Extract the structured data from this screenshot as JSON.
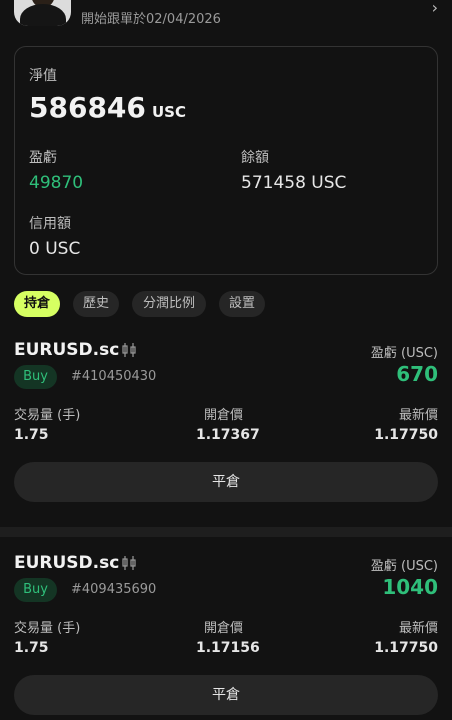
{
  "header": {
    "follow_since": "開始跟單於02/04/2026",
    "chevron": "›"
  },
  "account": {
    "equity_label": "淨值",
    "equity_value": "586846",
    "equity_unit": "USC",
    "pnl_label": "盈虧",
    "pnl_value": "49870",
    "balance_label": "餘額",
    "balance_value": "571458 USC",
    "credit_label": "信用額",
    "credit_value": "0 USC"
  },
  "tabs": [
    {
      "label": "持倉",
      "active": true
    },
    {
      "label": "歷史",
      "active": false
    },
    {
      "label": "分潤比例",
      "active": false
    },
    {
      "label": "設置",
      "active": false
    }
  ],
  "positions": [
    {
      "symbol": "EURUSD.sc",
      "side": "Buy",
      "ticket": "#410450430",
      "pnl_label": "盈虧 (USC)",
      "pnl_value": "670",
      "volume_label": "交易量 (手)",
      "volume": "1.75",
      "open_label": "開倉價",
      "open_price": "1.17367",
      "latest_label": "最新價",
      "latest_price": "1.17750",
      "close_label": "平倉"
    },
    {
      "symbol": "EURUSD.sc",
      "side": "Buy",
      "ticket": "#409435690",
      "pnl_label": "盈虧 (USC)",
      "pnl_value": "1040",
      "volume_label": "交易量 (手)",
      "volume": "1.75",
      "open_label": "開倉價",
      "open_price": "1.17156",
      "latest_label": "最新價",
      "latest_price": "1.17750",
      "close_label": "平倉"
    }
  ],
  "colors": {
    "accent": "#d6ff62",
    "profit": "#2fbf7a",
    "background": "#121212"
  },
  "icons": [
    "avatar",
    "chevron-right-icon",
    "candlestick-chart-icon"
  ]
}
